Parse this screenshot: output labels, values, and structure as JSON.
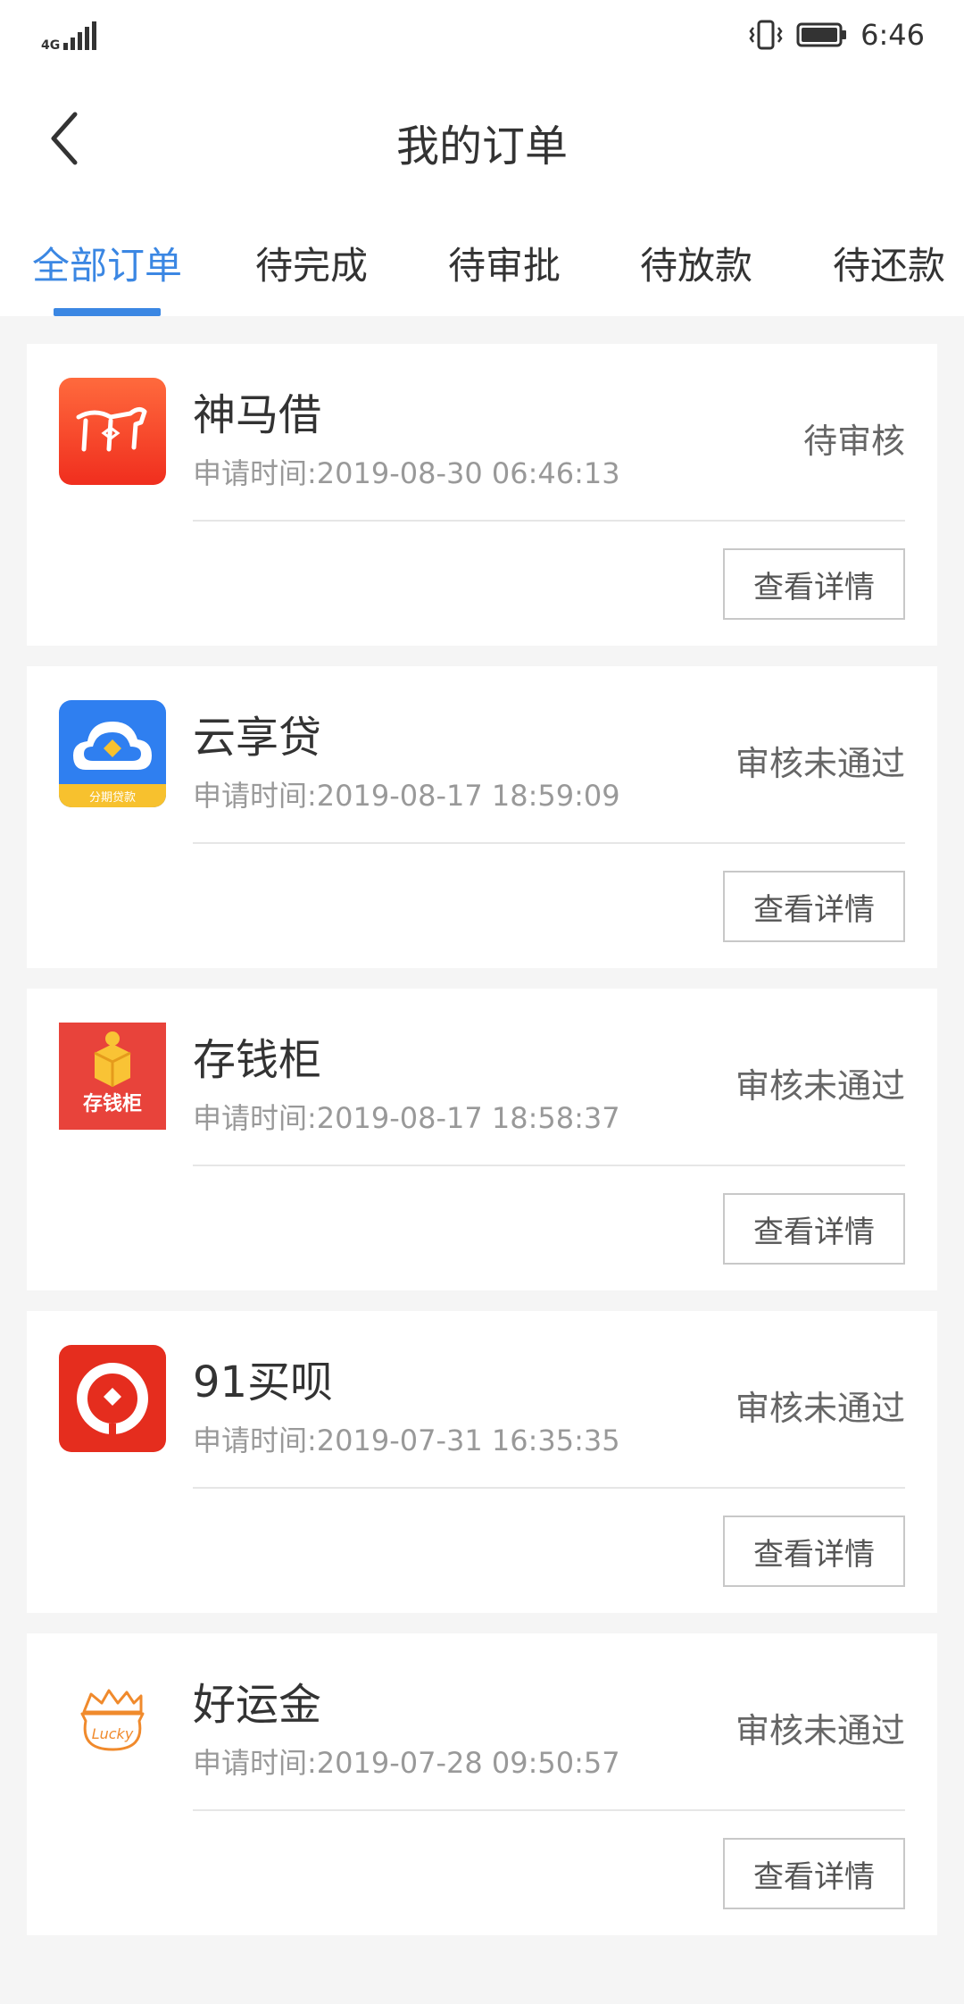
{
  "status_bar": {
    "network": "4G",
    "time": "6:46"
  },
  "header": {
    "title": "我的订单"
  },
  "tabs": [
    {
      "label": "全部订单",
      "active": true
    },
    {
      "label": "待完成",
      "active": false
    },
    {
      "label": "待审批",
      "active": false
    },
    {
      "label": "待放款",
      "active": false
    },
    {
      "label": "待还款",
      "active": false
    }
  ],
  "orders": [
    {
      "name": "神马借",
      "time": "申请时间:2019-08-30 06:46:13",
      "status": "待审核",
      "button": "查看详情",
      "logo": "horse-logo-icon"
    },
    {
      "name": "云享贷",
      "time": "申请时间:2019-08-17 18:59:09",
      "status": "审核未通过",
      "button": "查看详情",
      "logo": "cloud-logo-icon",
      "logo_caption": "分期贷款"
    },
    {
      "name": "存钱柜",
      "time": "申请时间:2019-08-17 18:58:37",
      "status": "审核未通过",
      "button": "查看详情",
      "logo": "piggy-box-logo-icon",
      "logo_caption": "存钱柜"
    },
    {
      "name": "91买呗",
      "time": "申请时间:2019-07-31 16:35:35",
      "status": "审核未通过",
      "button": "查看详情",
      "logo": "ring-logo-icon"
    },
    {
      "name": "好运金",
      "time": "申请时间:2019-07-28 09:50:57",
      "status": "审核未通过",
      "button": "查看详情",
      "logo": "lucky-bag-logo-icon",
      "logo_caption": "Lucky"
    }
  ],
  "colors": {
    "accent": "#3b87e3",
    "background": "#f5f5f5"
  }
}
